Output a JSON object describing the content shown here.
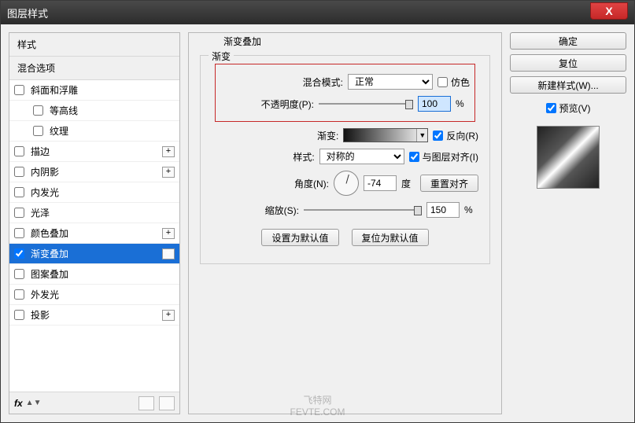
{
  "window": {
    "title": "图层样式"
  },
  "sidebar": {
    "header": "样式",
    "subheader": "混合选项",
    "items": [
      {
        "label": "斜面和浮雕",
        "checked": false,
        "plus": false,
        "indent": false
      },
      {
        "label": "等高线",
        "checked": false,
        "plus": false,
        "indent": true
      },
      {
        "label": "纹理",
        "checked": false,
        "plus": false,
        "indent": true
      },
      {
        "label": "描边",
        "checked": false,
        "plus": true,
        "indent": false
      },
      {
        "label": "内阴影",
        "checked": false,
        "plus": true,
        "indent": false
      },
      {
        "label": "内发光",
        "checked": false,
        "plus": false,
        "indent": false
      },
      {
        "label": "光泽",
        "checked": false,
        "plus": false,
        "indent": false
      },
      {
        "label": "颜色叠加",
        "checked": false,
        "plus": true,
        "indent": false
      },
      {
        "label": "渐变叠加",
        "checked": true,
        "plus": true,
        "indent": false,
        "selected": true
      },
      {
        "label": "图案叠加",
        "checked": false,
        "plus": false,
        "indent": false
      },
      {
        "label": "外发光",
        "checked": false,
        "plus": false,
        "indent": false
      },
      {
        "label": "投影",
        "checked": false,
        "plus": true,
        "indent": false
      }
    ],
    "footer_fx": "fx"
  },
  "main": {
    "group_title": "渐变叠加",
    "legend": "渐变",
    "blend_mode_label": "混合模式:",
    "blend_mode_value": "正常",
    "dither_label": "仿色",
    "opacity_label": "不透明度(P):",
    "opacity_value": "100",
    "opacity_unit": "%",
    "gradient_label": "渐变:",
    "reverse_label": "反向(R)",
    "style_label": "样式:",
    "style_value": "对称的",
    "align_label": "与图层对齐(I)",
    "angle_label": "角度(N):",
    "angle_value": "-74",
    "angle_unit": "度",
    "reset_align_label": "重置对齐",
    "scale_label": "缩放(S):",
    "scale_value": "150",
    "scale_unit": "%",
    "set_default_label": "设置为默认值",
    "reset_default_label": "复位为默认值"
  },
  "right": {
    "ok": "确定",
    "cancel": "复位",
    "new_style": "新建样式(W)...",
    "preview": "预览(V)"
  },
  "watermark": {
    "line1": "飞特网",
    "line2": "FEVTE.COM"
  }
}
